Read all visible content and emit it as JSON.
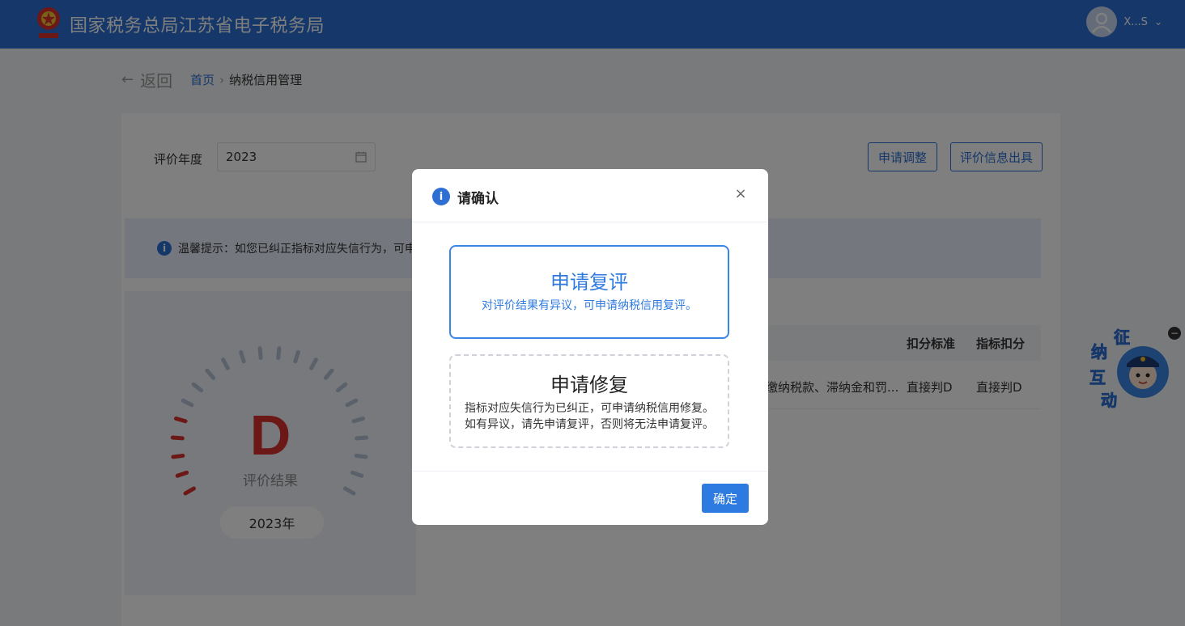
{
  "header": {
    "title": "国家税务总局江苏省电子税务局",
    "username": "X...S",
    "brand_color": "#2d6fd3"
  },
  "breadcrumb": {
    "back": "返回",
    "home": "首页",
    "separator": "›",
    "current": "纳税信用管理"
  },
  "filter": {
    "year_label": "评价年度",
    "year_value": "2023"
  },
  "actions": {
    "adjust": "申请调整",
    "issue": "评价信息出具"
  },
  "notice": {
    "text": "温馨提示：如您已纠正指标对应失信行为，可申"
  },
  "result": {
    "grade": "D",
    "label": "评价结果",
    "year": "2023年",
    "grade_color": "#d9302c"
  },
  "table": {
    "headers": [
      "扣分标准",
      "指标扣分"
    ],
    "row": {
      "desc": "缴纳税款、滞纳金和罚...",
      "standard": "直接判D",
      "score": "直接判D"
    }
  },
  "mascot": {
    "chars": [
      "征",
      "纳",
      "互",
      "动"
    ],
    "close": "−"
  },
  "dialog": {
    "title": "请确认",
    "close": "×",
    "review": {
      "title": "申请复评",
      "desc": "对评价结果有异议，可申请纳税信用复评。"
    },
    "repair": {
      "title": "申请修复",
      "desc_line1": "指标对应失信行为已纠正，可申请纳税信用修复。",
      "desc_line2": "如有异议，请先申请复评，否则将无法申请复评。"
    },
    "ok": "确定"
  }
}
